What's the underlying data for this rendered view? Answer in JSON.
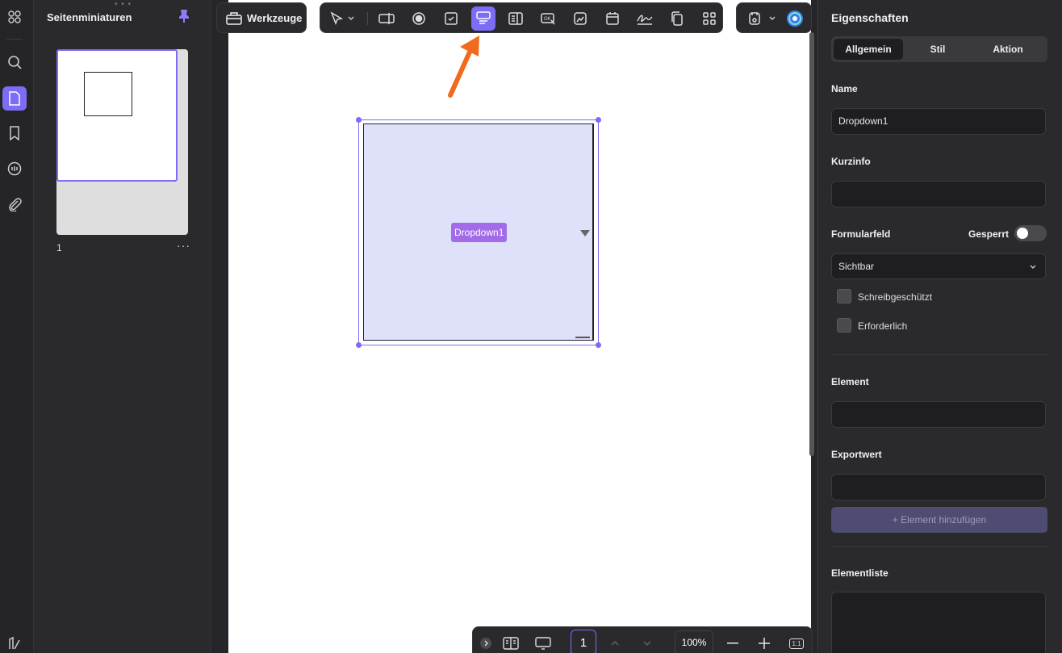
{
  "thumbnails": {
    "title": "Seitenminiaturen",
    "page_number": "1",
    "more": "···"
  },
  "toolbar": {
    "tools_label": "Werkzeuge"
  },
  "page_widget": {
    "dropdown_label": "Dropdown1"
  },
  "bottombar": {
    "page": "1",
    "zoom": "100%",
    "fit": "1:1"
  },
  "properties": {
    "title": "Eigenschaften",
    "tabs": [
      {
        "label": "Allgemein",
        "active": true
      },
      {
        "label": "Stil",
        "active": false
      },
      {
        "label": "Aktion",
        "active": false
      }
    ],
    "name_label": "Name",
    "name_value": "Dropdown1",
    "tooltip_label": "Kurzinfo",
    "tooltip_value": "",
    "formfield_label": "Formularfeld",
    "locked_label": "Gesperrt",
    "locked": false,
    "visibility_value": "Sichtbar",
    "readonly_label": "Schreibgeschützt",
    "required_label": "Erforderlich",
    "item_label": "Element",
    "export_label": "Exportwert",
    "add_item_label": "+ Element hinzufügen",
    "item_list_label": "Elementliste"
  },
  "colors": {
    "accent": "#7c6cf6",
    "annotation_arrow": "#f26a1b",
    "widget_fill": "#dfe1fb",
    "widget_label": "#a26be8"
  }
}
